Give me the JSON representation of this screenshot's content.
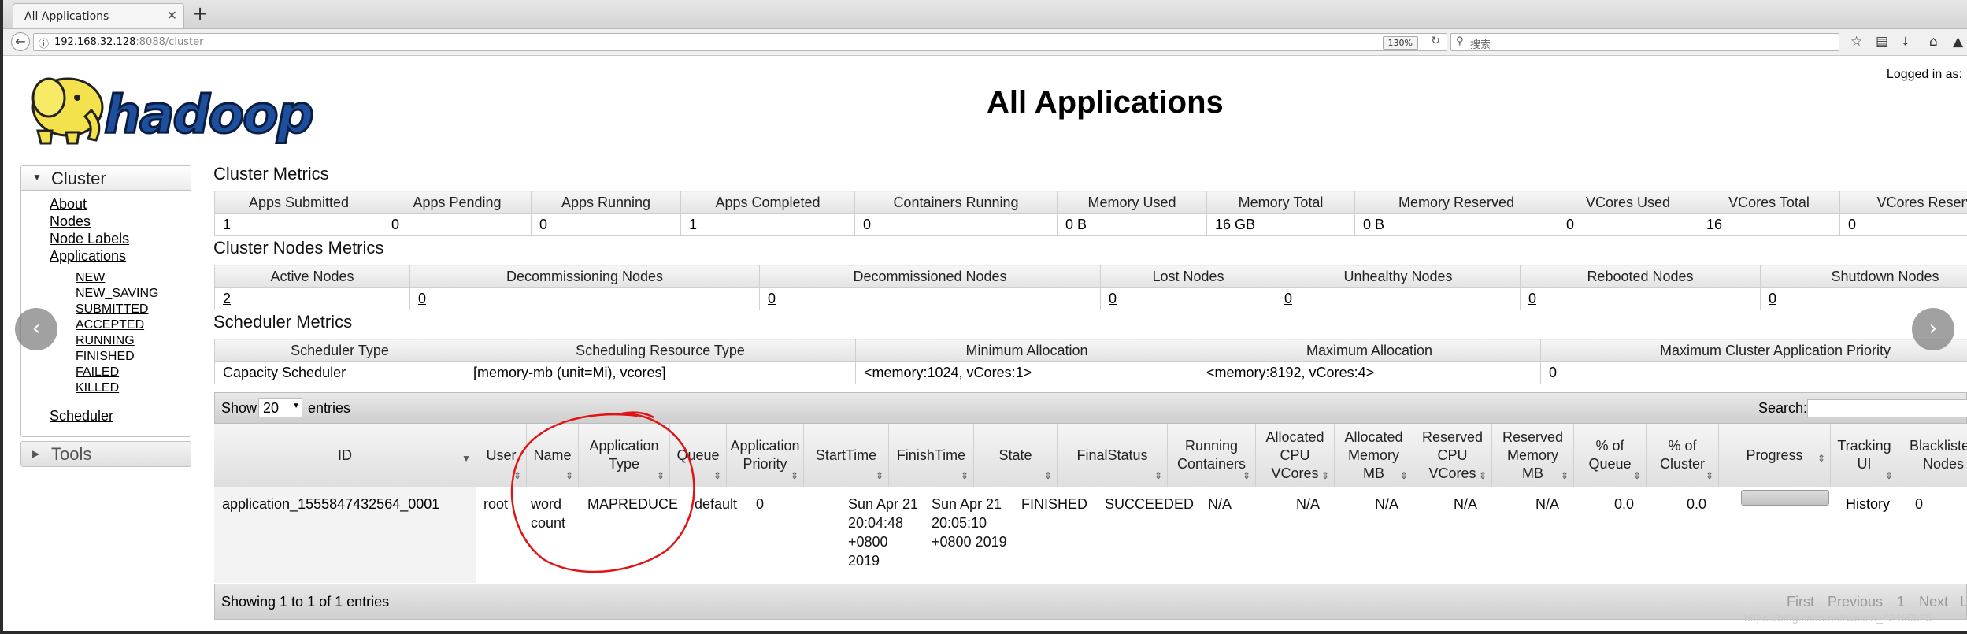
{
  "browser": {
    "tab_title": "All Applications",
    "new_tab": "+",
    "tab_close": "✕",
    "url_host": "192.168.32.128",
    "url_rest": ":8088/cluster",
    "zoom": "130%",
    "search_placeholder": "搜索"
  },
  "page": {
    "title": "All Applications",
    "logged_in": "Logged in as:"
  },
  "nav": {
    "cluster_label": "Cluster",
    "links": [
      "About",
      "Nodes",
      "Node Labels",
      "Applications"
    ],
    "app_states": [
      "NEW",
      "NEW_SAVING",
      "SUBMITTED",
      "ACCEPTED",
      "RUNNING",
      "FINISHED",
      "FAILED",
      "KILLED"
    ],
    "scheduler": "Scheduler",
    "tools_label": "Tools"
  },
  "cluster_metrics": {
    "title": "Cluster Metrics",
    "headers": [
      "Apps Submitted",
      "Apps Pending",
      "Apps Running",
      "Apps Completed",
      "Containers Running",
      "Memory Used",
      "Memory Total",
      "Memory Reserved",
      "VCores Used",
      "VCores Total",
      "VCores Reserved"
    ],
    "values": [
      "1",
      "0",
      "0",
      "1",
      "0",
      "0 B",
      "16 GB",
      "0 B",
      "0",
      "16",
      "0"
    ]
  },
  "nodes_metrics": {
    "title": "Cluster Nodes Metrics",
    "headers": [
      "Active Nodes",
      "Decommissioning Nodes",
      "Decommissioned Nodes",
      "Lost Nodes",
      "Unhealthy Nodes",
      "Rebooted Nodes",
      "Shutdown Nodes"
    ],
    "values": [
      "2",
      "0",
      "0",
      "0",
      "0",
      "0",
      "0"
    ]
  },
  "scheduler_metrics": {
    "title": "Scheduler Metrics",
    "headers": [
      "Scheduler Type",
      "Scheduling Resource Type",
      "Minimum Allocation",
      "Maximum Allocation",
      "Maximum Cluster Application Priority"
    ],
    "values": [
      "Capacity Scheduler",
      "[memory-mb (unit=Mi), vcores]",
      "<memory:1024, vCores:1>",
      "<memory:8192, vCores:4>",
      "0"
    ]
  },
  "apps_table": {
    "show_label": "Show",
    "page_size": "20",
    "entries_label": "entries",
    "search_label": "Search:",
    "headers": [
      "ID",
      "User",
      "Name",
      "Application Type",
      "Queue",
      "Application Priority",
      "StartTime",
      "FinishTime",
      "State",
      "FinalStatus",
      "Running Containers",
      "Allocated CPU VCores",
      "Allocated Memory MB",
      "Reserved CPU VCores",
      "Reserved Memory MB",
      "% of Queue",
      "% of Cluster",
      "Progress",
      "Tracking UI",
      "Blacklisted Nodes"
    ],
    "row": {
      "id": "application_1555847432564_0001",
      "user": "root",
      "name": "word count",
      "type": "MAPREDUCE",
      "queue": "default",
      "priority": "0",
      "start": "Sun Apr 21 20:04:48 +0800 2019",
      "finish": "Sun Apr 21 20:05:10 +0800 2019",
      "state": "FINISHED",
      "final": "SUCCEEDED",
      "running": "N/A",
      "alloc_cpu": "N/A",
      "alloc_mem": "N/A",
      "res_cpu": "N/A",
      "res_mem": "N/A",
      "pct_queue": "0.0",
      "pct_cluster": "0.0",
      "progress": 1.0,
      "tracking": "History",
      "blacklisted": "0"
    },
    "showing": "Showing 1 to 1 of 1 entries",
    "pager": [
      "First",
      "Previous",
      "1",
      "Next",
      "Last"
    ]
  },
  "watermark": "https://blog.csdn.net/weixin_42450528"
}
